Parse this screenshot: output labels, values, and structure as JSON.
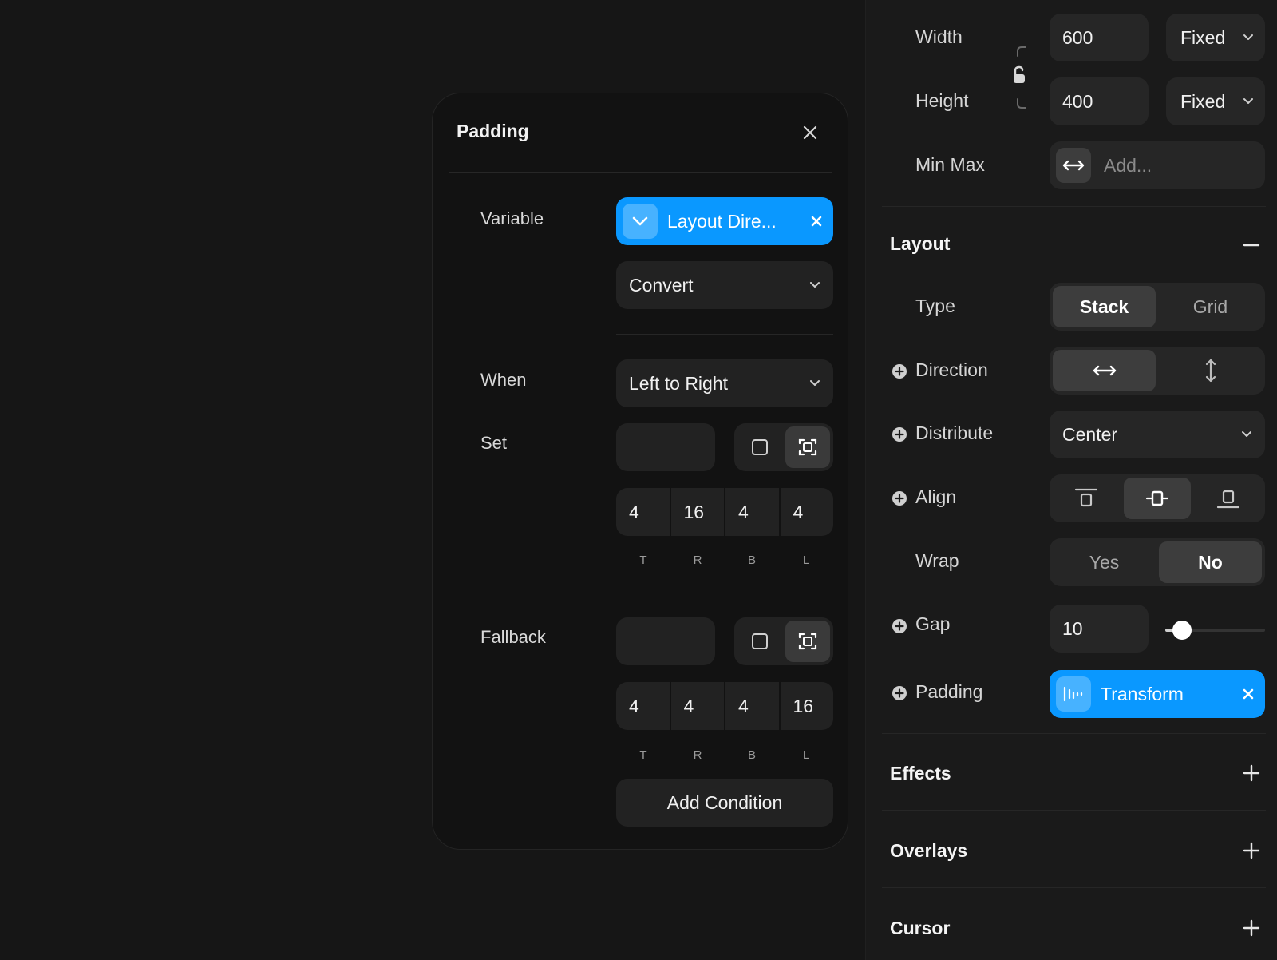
{
  "popup": {
    "title": "Padding",
    "variable_label": "Variable",
    "variable_value": "Layout Dire...",
    "convert_value": "Convert",
    "when_label": "When",
    "when_value": "Left to Right",
    "set_label": "Set",
    "set_values": [
      "4",
      "16",
      "4",
      "4"
    ],
    "side_labels": [
      "T",
      "R",
      "B",
      "L"
    ],
    "fallback_label": "Fallback",
    "fallback_values": [
      "4",
      "4",
      "4",
      "16"
    ],
    "add_condition": "Add Condition"
  },
  "sidebar": {
    "width_label": "Width",
    "width_value": "600",
    "width_mode": "Fixed",
    "height_label": "Height",
    "height_value": "400",
    "height_mode": "Fixed",
    "minmax_label": "Min Max",
    "minmax_placeholder": "Add...",
    "layout_title": "Layout",
    "type_label": "Type",
    "type_options": [
      "Stack",
      "Grid"
    ],
    "type_selected": "Stack",
    "direction_label": "Direction",
    "distribute_label": "Distribute",
    "distribute_value": "Center",
    "align_label": "Align",
    "wrap_label": "Wrap",
    "wrap_options": [
      "Yes",
      "No"
    ],
    "wrap_selected": "No",
    "gap_label": "Gap",
    "gap_value": "10",
    "gap_slider_fraction": 0.17,
    "padding_label": "Padding",
    "padding_variable": "Transform",
    "effects_title": "Effects",
    "overlays_title": "Overlays",
    "cursor_title": "Cursor"
  },
  "colors": {
    "accent": "#0a98ff",
    "background": "#151515",
    "field": "#222222"
  }
}
